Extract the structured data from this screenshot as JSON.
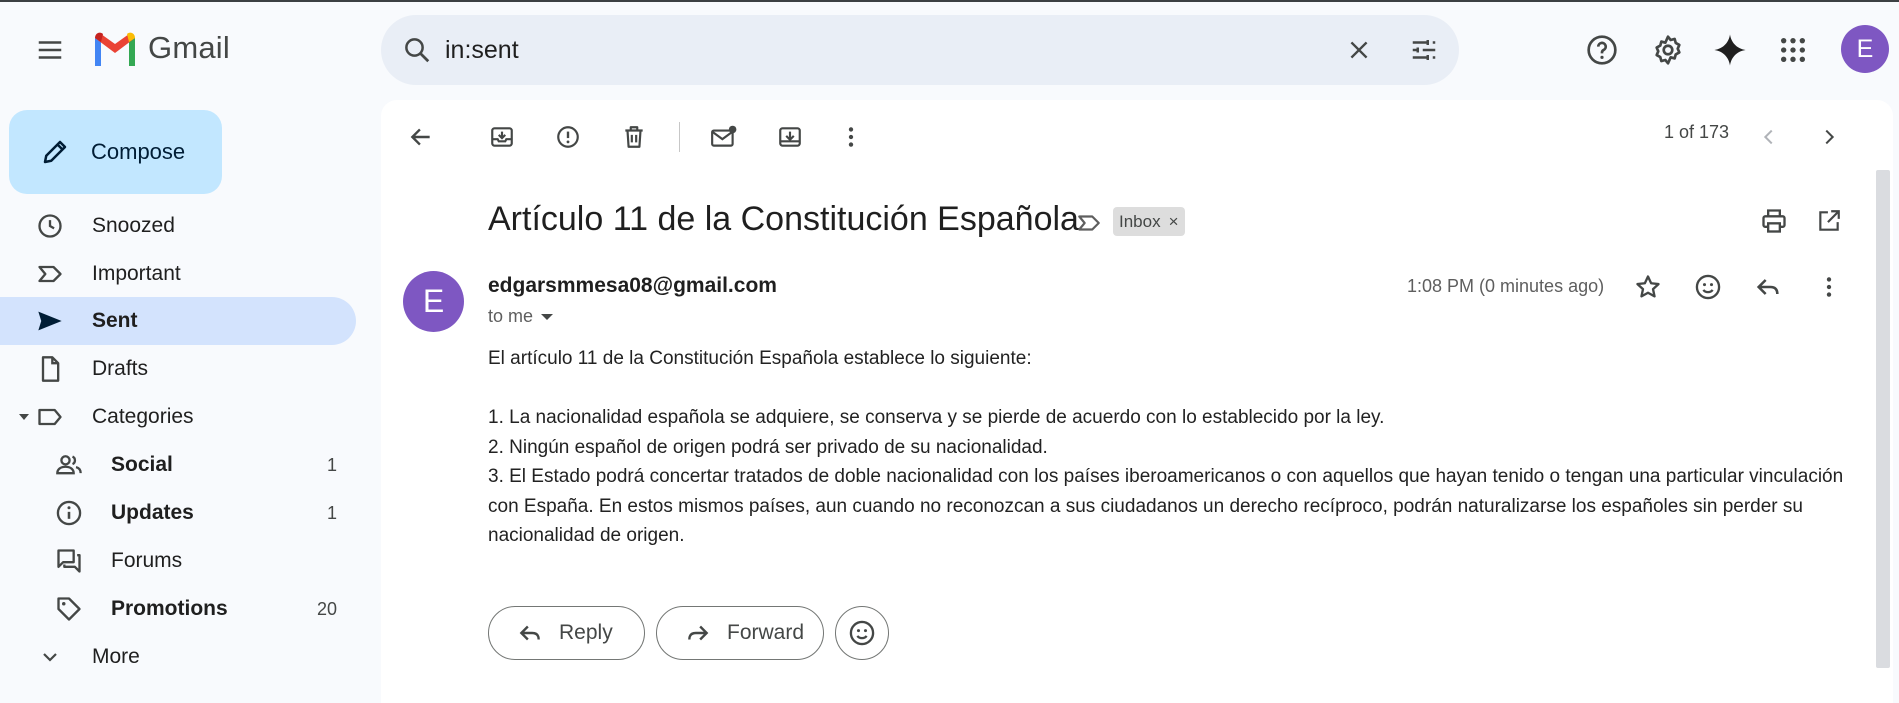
{
  "app": {
    "logo_text": "Gmail",
    "avatar_initial": "E"
  },
  "search": {
    "value": "in:sent",
    "placeholder": "Search mail"
  },
  "compose": {
    "label": "Compose"
  },
  "sidebar": {
    "items": [
      {
        "label": "Snoozed",
        "icon": "clock-icon"
      },
      {
        "label": "Important",
        "icon": "important-icon"
      },
      {
        "label": "Sent",
        "icon": "send-icon",
        "active": true
      },
      {
        "label": "Drafts",
        "icon": "draft-icon"
      },
      {
        "label": "Categories",
        "icon": "label-icon"
      },
      {
        "label": "Social",
        "icon": "people-icon",
        "count": "1"
      },
      {
        "label": "Updates",
        "icon": "info-icon",
        "count": "1"
      },
      {
        "label": "Forums",
        "icon": "forum-icon"
      },
      {
        "label": "Promotions",
        "icon": "tag-icon",
        "count": "20"
      },
      {
        "label": "More",
        "icon": "chevron-down-icon"
      }
    ]
  },
  "toolbar": {
    "pager_text": "1 of 173"
  },
  "email": {
    "subject": "Artículo 11 de la Constitución Española",
    "label": "Inbox",
    "label_close": "×",
    "sender": "edgarsmmesa08@gmail.com",
    "sender_initial": "E",
    "to": "to me",
    "timestamp": "1:08 PM (0 minutes ago)",
    "body": [
      "El artículo 11 de la Constitución Española establece lo siguiente:",
      "",
      "1. La nacionalidad española se adquiere, se conserva y se pierde de acuerdo con lo establecido por la ley.",
      "2. Ningún español de origen podrá ser privado de su nacionalidad.",
      "3. El Estado podrá concertar tratados de doble nacionalidad con los países iberoamericanos o con aquellos que hayan tenido o tengan una particular vinculación con España. En estos mismos países, aun cuando no reconozcan a sus ciudadanos un derecho recíproco, podrán naturalizarse los españoles sin perder su nacionalidad de origen."
    ]
  },
  "actions": {
    "reply": "Reply",
    "forward": "Forward"
  },
  "colors": {
    "accent": "#c2e7ff",
    "active_nav": "#d3e3fd",
    "avatar": "#7e57c2",
    "search_bg": "#e9eef6"
  }
}
